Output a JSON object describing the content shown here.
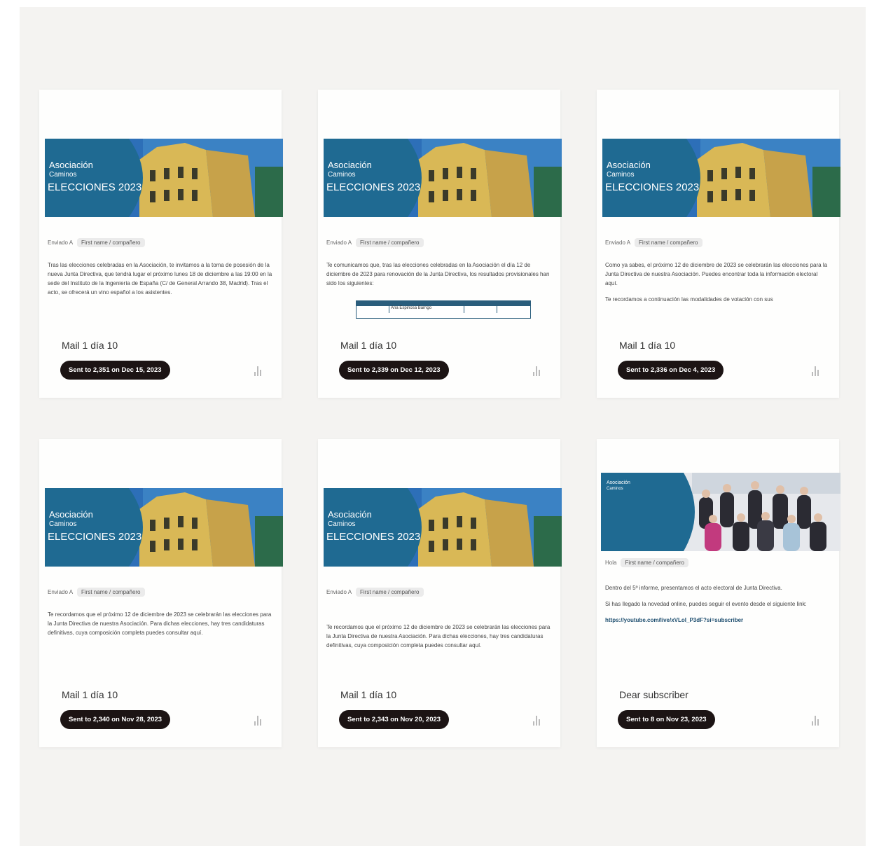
{
  "colors": {
    "banner_blue": "#1f6a92",
    "pill": "#1c1414",
    "canvas": "#f4f3f1"
  },
  "banner": {
    "org_line1": "Asociación",
    "org_line2": "Caminos",
    "title": "ELECCIONES 2023"
  },
  "cards": [
    {
      "from_label": "Enviado A",
      "list_chip": "First name / compañero",
      "preview": "Tras las elecciones celebradas en la Asociación, te invitamos a la toma de posesión de la nueva Junta Directiva, que tendrá lugar el próximo lunes 18 de diciembre a las 19:00 en la sede del Instituto de la Ingeniería de España (C/ de General Arrando 38, Madrid). Tras el acto, se ofrecerá un vino español a los asistentes.",
      "title": "Mail 1 día 10",
      "sent": "Sent to 2,351 on Dec 15, 2023"
    },
    {
      "from_label": "Enviado A",
      "list_chip": "First name / compañero",
      "preview": "Te comunicamos que, tras las elecciones celebradas en la Asociación el día 12 de diciembre de 2023 para renovación de la Junta Directiva, los resultados provisionales han sido los siguientes:",
      "table_row": "Ana Espinosa Barrigo",
      "title": "Mail 1 día 10",
      "sent": "Sent to 2,339 on Dec 12, 2023"
    },
    {
      "from_label": "Enviado A",
      "list_chip": "First name / compañero",
      "preview": "Como ya sabes, el próximo 12 de diciembre de 2023 se celebrarán las elecciones para la Junta Directiva de nuestra Asociación. Puedes encontrar toda la información electoral aquí.",
      "preview2": "Te recordamos a continuación las modalidades de votación con sus",
      "title": "Mail 1 día 10",
      "sent": "Sent to 2,336 on Dec 4, 2023"
    },
    {
      "from_label": "Enviado A",
      "list_chip": "First name / compañero",
      "preview": "Te recordamos que el próximo 12 de diciembre de 2023 se celebrarán las elecciones para la Junta Directiva de nuestra Asociación. Para dichas elecciones, hay tres candidaturas definitivas, cuya composición completa puedes consultar aquí.",
      "title": "Mail 1 día 10",
      "sent": "Sent to 2,340 on Nov 28, 2023"
    },
    {
      "from_label": "Enviado A",
      "list_chip": "First name / compañero",
      "preview": "Te recordamos que el próximo 12 de diciembre de 2023 se celebrarán las elecciones para la Junta Directiva de nuestra Asociación. Para dichas elecciones, hay tres candidaturas definitivas, cuya composición completa puedes consultar aquí.",
      "title": "Mail 1 día 10",
      "sent": "Sent to 2,343 on Nov 20, 2023"
    },
    {
      "from_label": "Hola",
      "list_chip": "First name / compañero",
      "preview": "Dentro del 5º informe, presentamos el acto electoral de Junta Directiva.",
      "preview2": "Si has llegado la novedad online, puedes seguir el evento desde el siguiente link:",
      "link": "https://youtube.com/live/xVLoI_P3dF?si=subscriber",
      "title": "Dear subscriber",
      "sent": "Sent to 8 on Nov 23, 2023"
    }
  ]
}
